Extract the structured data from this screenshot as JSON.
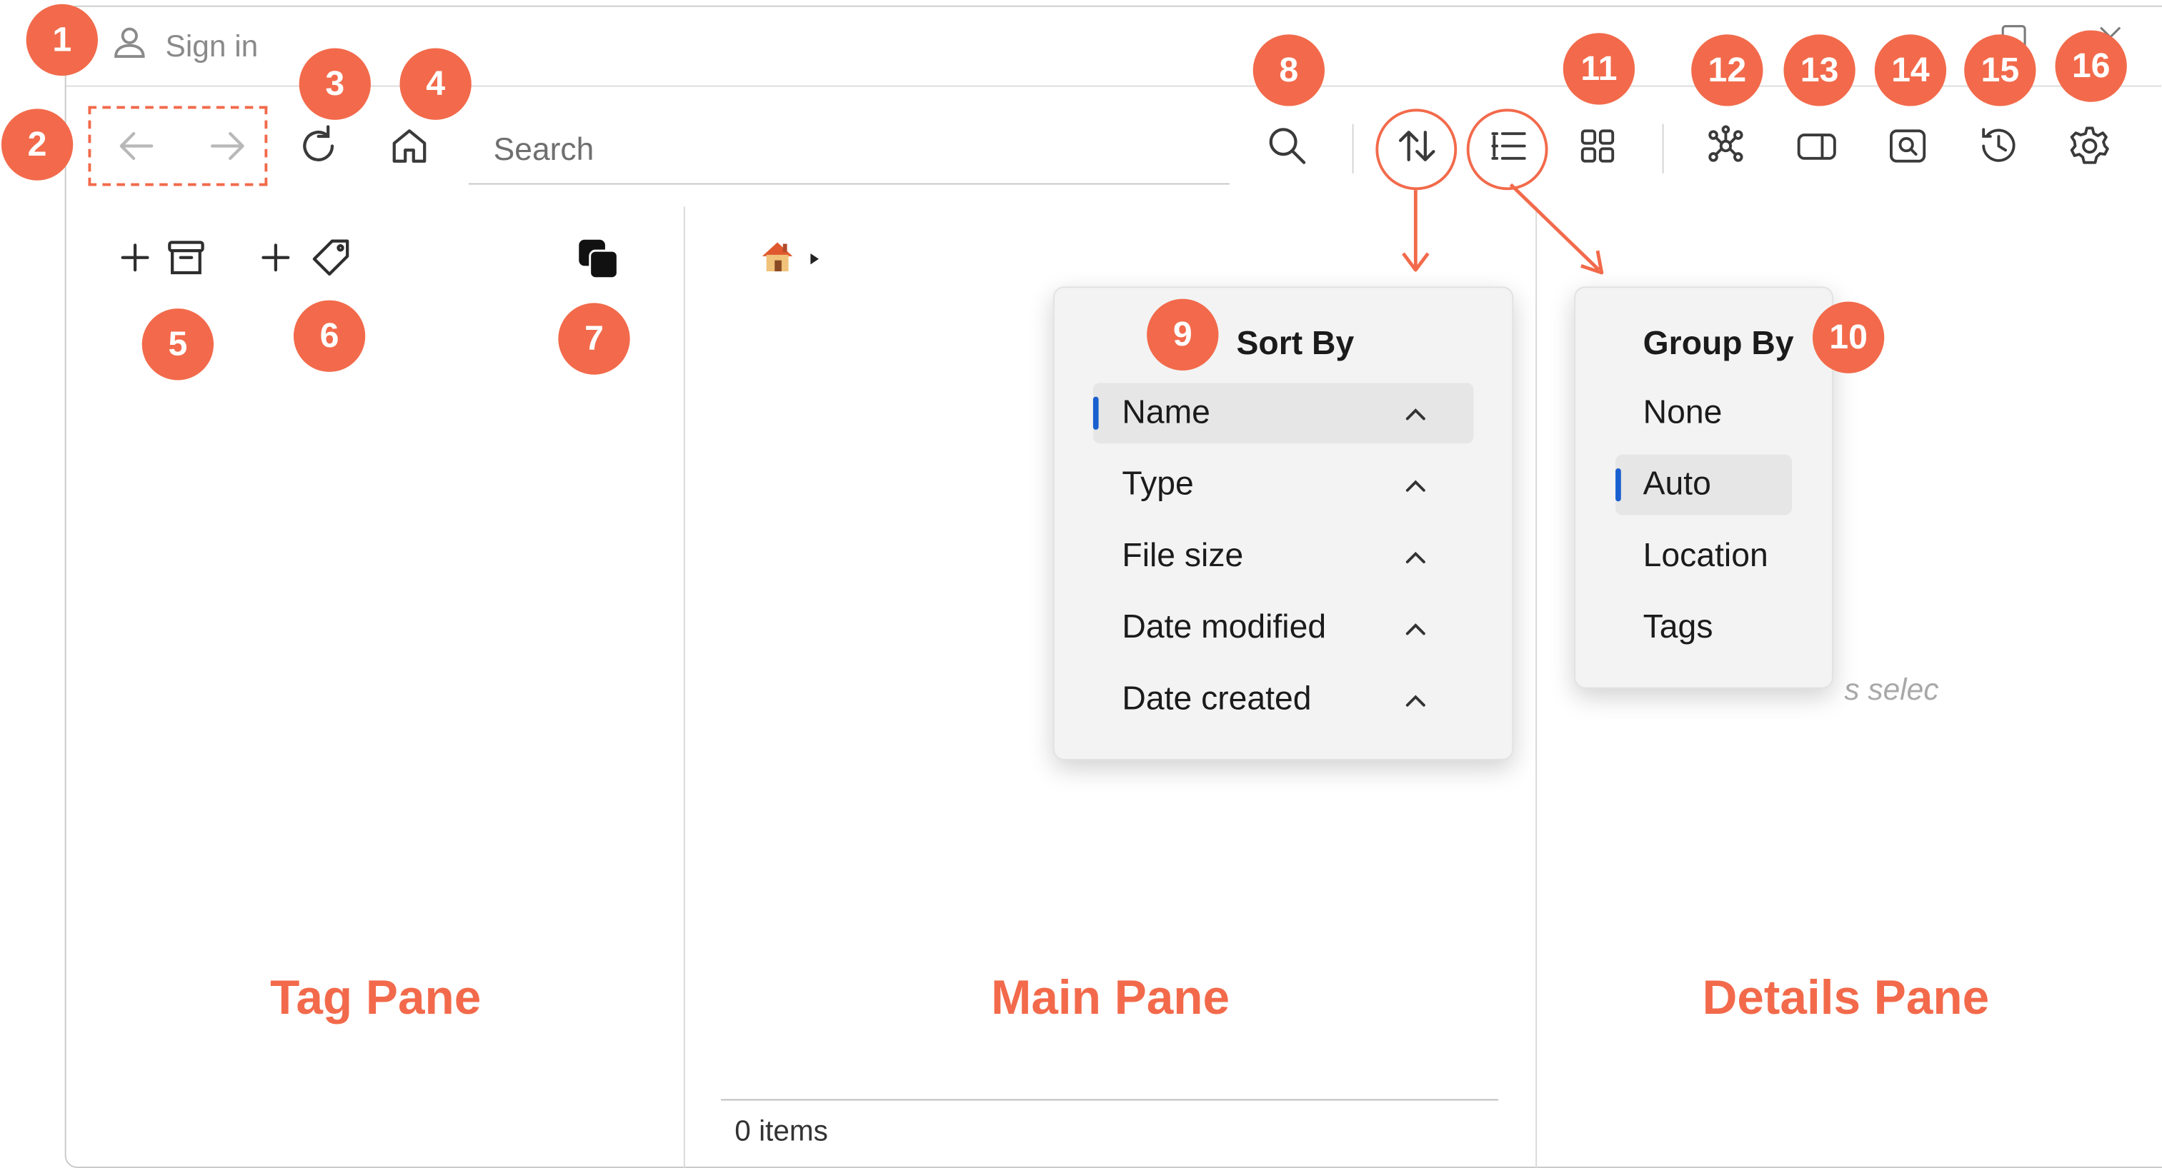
{
  "titlebar": {
    "signin_label": "Sign in",
    "icons": [
      "person-icon",
      "maximize-icon",
      "close-icon"
    ]
  },
  "toolbar": {
    "back_icon": "arrow-left-icon",
    "forward_icon": "arrow-right-icon",
    "refresh_icon": "refresh-icon",
    "home_icon": "home-icon",
    "search_placeholder": "Search",
    "search_icon": "search-icon",
    "sort_icon": "sort-arrows-icon",
    "group_icon": "list-group-icon",
    "view_icon": "grid-view-icon",
    "graph_icon": "graph-nodes-icon",
    "details_toggle_icon": "panel-toggle-icon",
    "preview_icon": "preview-search-icon",
    "history_icon": "history-icon",
    "settings_icon": "gear-icon"
  },
  "tag_pane": {
    "add_location_icon": "add-archive-icon",
    "add_tag_icon": "add-tag-icon",
    "overlap_icon": "overlapping-squares-icon",
    "label": "Tag Pane"
  },
  "main_pane": {
    "breadcrumb_icon": "home-emoji-icon",
    "status": "0 items",
    "label": "Main Pane"
  },
  "details_pane": {
    "ghost_text": "s selec",
    "label": "Details Pane"
  },
  "sort_menu": {
    "title": "Sort By",
    "items": [
      {
        "label": "Name",
        "selected": true
      },
      {
        "label": "Type",
        "selected": false
      },
      {
        "label": "File size",
        "selected": false
      },
      {
        "label": "Date modified",
        "selected": false
      },
      {
        "label": "Date created",
        "selected": false
      }
    ]
  },
  "group_menu": {
    "title": "Group By",
    "items": [
      {
        "label": "None",
        "selected": false
      },
      {
        "label": "Auto",
        "selected": true
      },
      {
        "label": "Location",
        "selected": false
      },
      {
        "label": "Tags",
        "selected": false
      }
    ]
  },
  "badges": [
    "1",
    "2",
    "3",
    "4",
    "5",
    "6",
    "7",
    "8",
    "9",
    "10",
    "11",
    "12",
    "13",
    "14",
    "15",
    "16"
  ],
  "colors": {
    "accent": "#f26a4b",
    "selection": "#1a5fd0",
    "popup_bg": "#f3f3f3",
    "icon": "#3a3a3a"
  }
}
